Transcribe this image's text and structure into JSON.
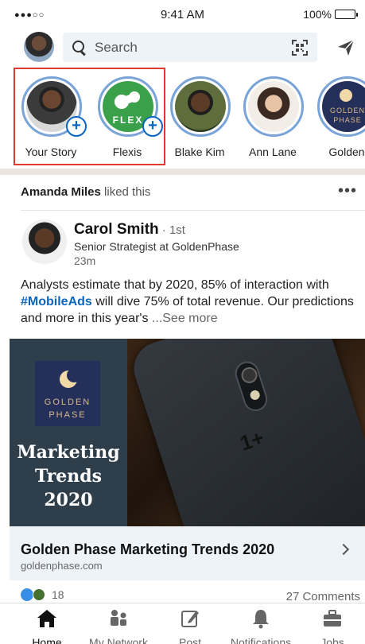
{
  "status_bar": {
    "signal": "●●●○○",
    "time": "9:41 AM",
    "battery": "100%"
  },
  "header": {
    "search_placeholder": "Search"
  },
  "stories": [
    {
      "label": "Your Story",
      "has_add": true
    },
    {
      "label": "Flexis",
      "has_add": true,
      "logo_text": "FLEX"
    },
    {
      "label": "Blake Kim"
    },
    {
      "label": "Ann Lane"
    },
    {
      "label": "Golden",
      "logo_text_1": "GOLDEN",
      "logo_text_2": "PHASE"
    }
  ],
  "post": {
    "liked_by_name": "Amanda Miles",
    "liked_by_action": " liked this",
    "more": "•••",
    "author_name": "Carol Smith",
    "author_degree": " · 1st",
    "author_title": "Senior Strategist at GoldenPhase",
    "author_time": "23m",
    "text_before": "Analysts estimate that by 2020, 85% of interaction with ",
    "hashtag": "#MobileAds",
    "text_after": " will dive 75% of total revenue. Our predictions and more in this year's ",
    "see_more": "...See more",
    "image": {
      "logo_line1": "GOLDEN",
      "logo_line2": "PHASE",
      "headline_1": "Marketing",
      "headline_2": "Trends",
      "headline_3": "2020",
      "phone_mark": "1+"
    },
    "link_title": "Golden Phase Marketing Trends 2020",
    "link_domain": "goldenphase.com",
    "reaction_count": "18",
    "comments": "27 Comments"
  },
  "nav": [
    {
      "label": "Home",
      "active": true
    },
    {
      "label": "My Network"
    },
    {
      "label": "Post"
    },
    {
      "label": "Notifications"
    },
    {
      "label": "Jobs"
    }
  ]
}
